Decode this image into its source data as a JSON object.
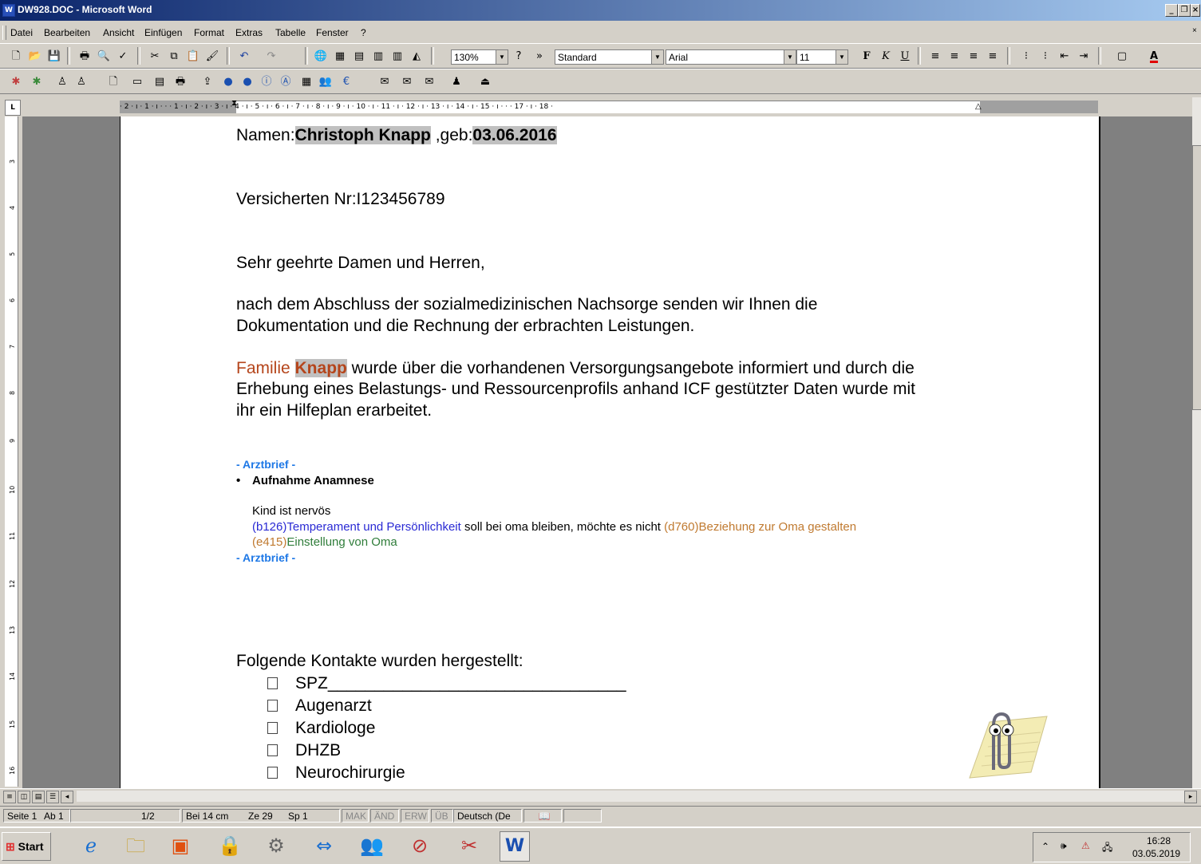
{
  "window": {
    "title": "DW928.DOC - Microsoft Word"
  },
  "menu": [
    "Datei",
    "Bearbeiten",
    "Ansicht",
    "Einfügen",
    "Format",
    "Extras",
    "Tabelle",
    "Fenster",
    "?"
  ],
  "toolbar": {
    "zoom": "130%",
    "style": "Standard",
    "font": "Arial",
    "size": "11"
  },
  "ruler": {
    "marks": "· 2 · ı · 1 · ı · · · 1 · ı · 2 · ı · 3 · ı · 4 · ı · 5 · ı · 6 · ı · 7 · ı · 8 · ı · 9 · ı · 10 · ı · 11 · ı · 12 · ı · 13 · ı · 14 · ı · 15 · ı · · · 17 · ı · 18 ·"
  },
  "document": {
    "name_label": "Namen:",
    "name_value": "Christoph Knapp",
    "geb_label": " ,geb:",
    "geb_value": "03.06.2016",
    "versicherten": "Versicherten Nr:I123456789",
    "greeting": "Sehr geehrte Damen und Herren,",
    "para1_line1": "nach dem Abschluss der sozialmedizinischen Nachsorge senden wir Ihnen die",
    "para1_line2": "Dokumentation und die Rechnung der erbrachten  Leistungen.",
    "para2_familie": "Familie ",
    "para2_knapp": "Knapp",
    "para2_rest1": " wurde über die vorhandenen Versorgungsangebote informiert und durch die",
    "para2_line2": "Erhebung eines Belastungs- und Ressourcenprofils anhand ICF gestützter Daten wurde mit",
    "para2_line3": "ihr ein Hilfeplan erarbeitet.",
    "arztbrief_start": "- Arztbrief -",
    "bullet_heading": "Aufnahme Anamnese",
    "kind": "Kind ist nervös",
    "code1": "(b126)",
    "code1_text": "Temperament und Persönlichkeit",
    "plain1": " soll bei oma bleiben, möchte es nicht ",
    "code2": "(d760)",
    "code2_text": "Beziehung zur Oma gestalten",
    "code3": "(e415)",
    "code3_text": "Einstellung von Oma",
    "arztbrief_end": "- Arztbrief -",
    "contacts_heading": "Folgende Kontakte wurden hergestellt:",
    "contacts": [
      "SPZ",
      "Augenarzt",
      "Kardiologe",
      "DHZB",
      "Neurochirurgie"
    ],
    "spz_underline": "________________________________"
  },
  "status": {
    "seite": "Seite 1",
    "ab": "Ab 1",
    "pages": "1/2",
    "bei": "Bei 14 cm",
    "ze": "Ze 29",
    "sp": "Sp 1",
    "mak": "MAK",
    "aend": "ÄND",
    "erw": "ERW",
    "ueb": "ÜB",
    "lang": "Deutsch (De"
  },
  "taskbar": {
    "start": "Start",
    "time": "16:28",
    "date": "03.05.2019"
  },
  "colors": {
    "title_start": "#0a246a",
    "title_end": "#a6caf0",
    "arztbrief": "#1e78e6",
    "code_blue": "#2a2ad4",
    "code_orange": "#c07a30",
    "code_green": "#2f7d3a",
    "familie": "#b5451b"
  }
}
